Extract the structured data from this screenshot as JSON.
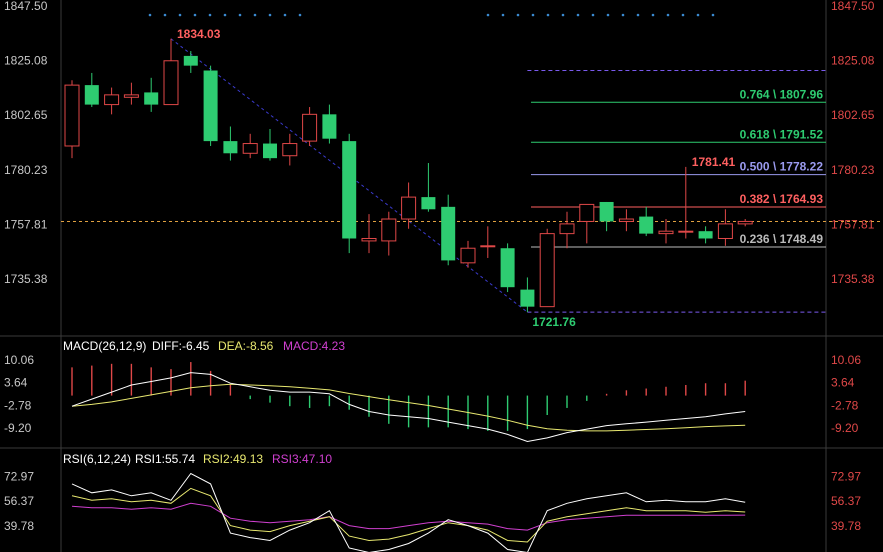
{
  "colors": {
    "up": "#e04848",
    "down": "#2ecc71",
    "dif": "#ffffff",
    "dea": "#e8e870",
    "rsi1": "#ffffff",
    "rsi2": "#e8e870",
    "rsi3": "#d040d0",
    "grid": "#3a3a3a",
    "trend": "#3a3acc",
    "fib_green": "#2ecc71",
    "fib_blue": "#9a9aee",
    "fib_red": "#ff6060",
    "fib_gray": "#bbbbbb"
  },
  "chart_data": [
    {
      "type": "candlestick",
      "name": "price",
      "y_ticks": [
        "1847.50",
        "1825.08",
        "1802.65",
        "1780.23",
        "1757.81",
        "1735.38"
      ],
      "ylim": [
        1714.0,
        1847.5
      ],
      "candles": [
        {
          "o": 1790.0,
          "h": 1817.0,
          "l": 1785.0,
          "c": 1815.0
        },
        {
          "o": 1815.0,
          "h": 1820.0,
          "l": 1806.0,
          "c": 1807.0
        },
        {
          "o": 1807.0,
          "h": 1814.0,
          "l": 1803.0,
          "c": 1811.0
        },
        {
          "o": 1810.0,
          "h": 1816.0,
          "l": 1807.0,
          "c": 1811.0
        },
        {
          "o": 1812.0,
          "h": 1818.0,
          "l": 1804.0,
          "c": 1807.0
        },
        {
          "o": 1807.0,
          "h": 1834.03,
          "l": 1807.0,
          "c": 1825.0
        },
        {
          "o": 1827.0,
          "h": 1829.0,
          "l": 1820.0,
          "c": 1823.0
        },
        {
          "o": 1821.0,
          "h": 1823.0,
          "l": 1790.0,
          "c": 1792.0
        },
        {
          "o": 1792.0,
          "h": 1798.0,
          "l": 1784.0,
          "c": 1787.0
        },
        {
          "o": 1787.0,
          "h": 1795.0,
          "l": 1785.0,
          "c": 1791.0
        },
        {
          "o": 1791.0,
          "h": 1797.0,
          "l": 1784.0,
          "c": 1785.0
        },
        {
          "o": 1786.0,
          "h": 1795.0,
          "l": 1782.0,
          "c": 1791.0
        },
        {
          "o": 1792.0,
          "h": 1806.0,
          "l": 1790.0,
          "c": 1803.0
        },
        {
          "o": 1803.0,
          "h": 1807.0,
          "l": 1791.0,
          "c": 1793.0
        },
        {
          "o": 1792.0,
          "h": 1795.0,
          "l": 1746.0,
          "c": 1752.0
        },
        {
          "o": 1751.0,
          "h": 1762.0,
          "l": 1746.0,
          "c": 1752.0
        },
        {
          "o": 1751.0,
          "h": 1763.0,
          "l": 1745.0,
          "c": 1760.0
        },
        {
          "o": 1760.0,
          "h": 1775.0,
          "l": 1756.0,
          "c": 1769.0
        },
        {
          "o": 1769.0,
          "h": 1783.0,
          "l": 1763.0,
          "c": 1764.0
        },
        {
          "o": 1765.0,
          "h": 1770.0,
          "l": 1741.0,
          "c": 1743.0
        },
        {
          "o": 1742.0,
          "h": 1751.0,
          "l": 1740.0,
          "c": 1748.0
        },
        {
          "o": 1749.0,
          "h": 1757.0,
          "l": 1744.0,
          "c": 1749.0
        },
        {
          "o": 1748.0,
          "h": 1750.0,
          "l": 1730.0,
          "c": 1732.0
        },
        {
          "o": 1731.0,
          "h": 1736.0,
          "l": 1721.76,
          "c": 1724.0
        },
        {
          "o": 1724.0,
          "h": 1756.0,
          "l": 1724.0,
          "c": 1754.0
        },
        {
          "o": 1754.0,
          "h": 1763.0,
          "l": 1748.0,
          "c": 1758.0
        },
        {
          "o": 1759.0,
          "h": 1766.0,
          "l": 1750.0,
          "c": 1766.0
        },
        {
          "o": 1767.0,
          "h": 1767.0,
          "l": 1755.0,
          "c": 1759.0
        },
        {
          "o": 1759.0,
          "h": 1764.0,
          "l": 1755.0,
          "c": 1760.0
        },
        {
          "o": 1761.0,
          "h": 1765.0,
          "l": 1753.0,
          "c": 1754.0
        },
        {
          "o": 1754.0,
          "h": 1760.0,
          "l": 1750.0,
          "c": 1755.0
        },
        {
          "o": 1755.0,
          "h": 1781.41,
          "l": 1752.0,
          "c": 1755.0
        },
        {
          "o": 1755.0,
          "h": 1757.0,
          "l": 1750.0,
          "c": 1752.0
        },
        {
          "o": 1752.0,
          "h": 1764.0,
          "l": 1749.0,
          "c": 1758.0
        },
        {
          "o": 1758.0,
          "h": 1760.0,
          "l": 1757.0,
          "c": 1759.0
        }
      ],
      "annotations": [
        {
          "text": "1834.03",
          "candle": 5,
          "value": 1834.03,
          "color": "#ff6060",
          "place": "above"
        },
        {
          "text": "1721.76",
          "candle": 23,
          "value": 1721.76,
          "color": "#2ecc71",
          "place": "below"
        },
        {
          "text": "1781.41",
          "candle": 31,
          "value": 1781.41,
          "color": "#ff6060",
          "place": "above"
        }
      ],
      "fib_levels": [
        {
          "value": 1821.0,
          "label": "",
          "color": "#7a5aee",
          "dashed": true
        },
        {
          "value": 1807.96,
          "label": "0.764 \\ 1807.96",
          "color": "#2ecc71"
        },
        {
          "value": 1791.52,
          "label": "0.618 \\ 1791.52",
          "color": "#2ecc71"
        },
        {
          "value": 1778.22,
          "label": "0.500 \\ 1778.22",
          "color": "#9a9aee"
        },
        {
          "value": 1764.93,
          "label": "0.382 \\ 1764.93",
          "color": "#ff6060"
        },
        {
          "value": 1748.49,
          "label": "0.236 \\ 1748.49",
          "color": "#bbbbbb"
        },
        {
          "value": 1721.76,
          "label": "",
          "color": "#7a5aee",
          "dashed": true
        }
      ],
      "current_price": 1759.0
    },
    {
      "type": "macd",
      "name": "MACD",
      "label": "MACD(26,12,9)",
      "dif_text": "DIFF:-6.45",
      "dea_text": "DEA:-8.56",
      "macd_text": "MACD:4.23",
      "y_ticks": [
        "10.06",
        "3.64",
        "-2.78",
        "-9.20"
      ],
      "ylim": [
        -14.0,
        11.5
      ],
      "dif": [
        -3.0,
        -1.0,
        1.0,
        3.0,
        4.0,
        5.0,
        6.5,
        6.0,
        3.5,
        2.5,
        1.5,
        1.0,
        1.0,
        0.5,
        -2.5,
        -4.5,
        -5.5,
        -6.0,
        -6.5,
        -7.5,
        -8.5,
        -9.5,
        -11.0,
        -13.0,
        -12.0,
        -10.5,
        -9.5,
        -8.5,
        -8.0,
        -7.5,
        -7.0,
        -6.5,
        -6.0,
        -5.2,
        -4.5
      ],
      "dea": [
        -3.0,
        -2.5,
        -1.8,
        -0.8,
        0.2,
        1.2,
        2.2,
        2.8,
        3.2,
        3.0,
        2.8,
        2.5,
        2.1,
        1.6,
        0.6,
        -0.3,
        -1.2,
        -2.0,
        -2.8,
        -3.8,
        -4.8,
        -5.8,
        -7.0,
        -8.4,
        -9.4,
        -9.8,
        -10.0,
        -10.0,
        -9.8,
        -9.6,
        -9.4,
        -9.1,
        -8.8,
        -8.6,
        -8.4
      ],
      "hist": [
        8.0,
        8.5,
        9.0,
        9.0,
        8.0,
        7.5,
        9.5,
        7.0,
        3.0,
        -1.0,
        -2.0,
        -3.0,
        -3.5,
        -3.0,
        -4.0,
        -6.0,
        -8.0,
        -9.0,
        -9.0,
        -9.0,
        -9.5,
        -10.0,
        -10.0,
        -9.5,
        -5.5,
        -3.5,
        -1.5,
        0.5,
        1.5,
        2.0,
        2.5,
        3.0,
        3.5,
        3.5,
        4.23
      ]
    },
    {
      "type": "line",
      "name": "RSI",
      "label": "RSI(6,12,24)",
      "rsi1_text": "RSI1:55.74",
      "rsi2_text": "RSI2:49.13",
      "rsi3_text": "RSI3:47.10",
      "y_ticks": [
        "72.97",
        "56.37",
        "39.78"
      ],
      "ylim": [
        25.0,
        80.0
      ],
      "rsi1": [
        68,
        62,
        64,
        60,
        62,
        57,
        75,
        68,
        35,
        32,
        30,
        37,
        42,
        50,
        25,
        22,
        24,
        28,
        35,
        44,
        40,
        35,
        24,
        22,
        50,
        55,
        58,
        60,
        62,
        56,
        57,
        56,
        56,
        58,
        55.74
      ],
      "rsi2": [
        60,
        57,
        58,
        56,
        57,
        55,
        65,
        60,
        40,
        37,
        36,
        40,
        43,
        46,
        33,
        30,
        31,
        34,
        38,
        42,
        40,
        37,
        30,
        29,
        43,
        46,
        48,
        50,
        52,
        50,
        50,
        50,
        49,
        50,
        49.13
      ],
      "rsi3": [
        53,
        52,
        52,
        51,
        52,
        51,
        55,
        53,
        45,
        43,
        42,
        43,
        44,
        46,
        40,
        38,
        38,
        40,
        42,
        43,
        42,
        41,
        38,
        37,
        42,
        44,
        45,
        46,
        47,
        47,
        47,
        47,
        47,
        47,
        47.1
      ]
    }
  ]
}
